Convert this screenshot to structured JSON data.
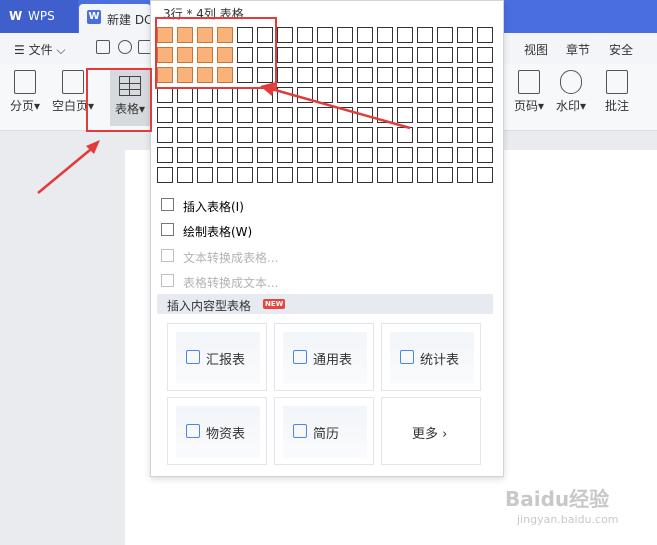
{
  "titlebar": {
    "app_tab": "WPS",
    "doc_tab": "新建 DC"
  },
  "menubar": {
    "file": "文件",
    "right_items": [
      "视图",
      "章节",
      "安全"
    ]
  },
  "ribbon": {
    "left_buttons": [
      "分页",
      "空白页",
      "表格"
    ],
    "right_buttons": [
      "页码",
      "水印",
      "批注"
    ]
  },
  "grid": {
    "title": "3行 * 4列 表格",
    "rows": 8,
    "cols": 17,
    "selected_rows": 3,
    "selected_cols": 4
  },
  "menu": {
    "insert_table": "插入表格(I)",
    "draw_table": "绘制表格(W)",
    "text_to_table": "文本转换成表格...",
    "table_to_text": "表格转换成文本..."
  },
  "section": {
    "title": "插入内容型表格",
    "badge": "NEW"
  },
  "cards": [
    "汇报表",
    "通用表",
    "统计表",
    "物资表",
    "简历",
    "更多"
  ],
  "watermark": {
    "brand": "Baidu经验",
    "url": "jingyan.baidu.com"
  },
  "colors": {
    "accent": "#4a6ee0",
    "selected_cell": "#f8b27a",
    "annotation_red": "#e23b3b"
  }
}
